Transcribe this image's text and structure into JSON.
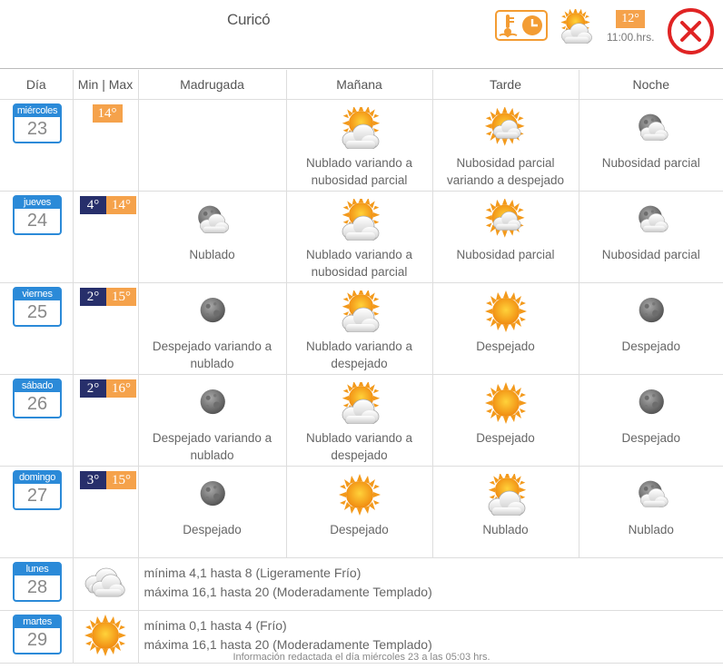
{
  "header": {
    "city": "Curicó",
    "current_temp": "12°",
    "current_hour": "11:00.hrs.",
    "icons": [
      "thermometer-clock-icon",
      "partly-cloudy-icon",
      "close-icon"
    ]
  },
  "table": {
    "headers": [
      "Día",
      "Min | Max",
      "Madrugada",
      "Mañana",
      "Tarde",
      "Noche"
    ],
    "days": [
      {
        "name": "miércoles",
        "num": "23",
        "min": "",
        "max": "14°",
        "madrugada": "",
        "manana": "Nublado variando a nubosidad parcial",
        "tarde": "Nubosidad parcial variando a despejado",
        "noche": "Nubosidad parcial"
      },
      {
        "name": "jueves",
        "num": "24",
        "min": "4°",
        "max": "14°",
        "madrugada": "Nublado",
        "manana": "Nublado variando a nubosidad parcial",
        "tarde": "Nubosidad parcial",
        "noche": "Nubosidad parcial"
      },
      {
        "name": "viernes",
        "num": "25",
        "min": "2°",
        "max": "15°",
        "madrugada": "Despejado variando a nublado",
        "manana": "Nublado variando a despejado",
        "tarde": "Despejado",
        "noche": "Despejado"
      },
      {
        "name": "sábado",
        "num": "26",
        "min": "2°",
        "max": "16°",
        "madrugada": "Despejado variando a nublado",
        "manana": "Nublado variando a despejado",
        "tarde": "Despejado",
        "noche": "Despejado"
      },
      {
        "name": "domingo",
        "num": "27",
        "min": "3°",
        "max": "15°",
        "madrugada": "Despejado",
        "manana": "Despejado",
        "tarde": "Nublado",
        "noche": "Nublado"
      }
    ],
    "extended": [
      {
        "name": "lunes",
        "num": "28",
        "line1": "mínima 4,1 hasta 8 (Ligeramente Frío)",
        "line2": "máxima 16,1 hasta 20 (Moderadamente Templado)"
      },
      {
        "name": "martes",
        "num": "29",
        "line1": "mínima 0,1 hasta 4 (Frío)",
        "line2": "máxima 16,1 hasta 20 (Moderadamente Templado)"
      }
    ]
  },
  "footer": "Información redactada el día miércoles 23 a las 05:03 hrs.",
  "colors": {
    "accent_blue": "#2b8ad8",
    "max_orange": "#f5a24b",
    "min_navy": "#272f6b",
    "close_red": "#e02424"
  }
}
